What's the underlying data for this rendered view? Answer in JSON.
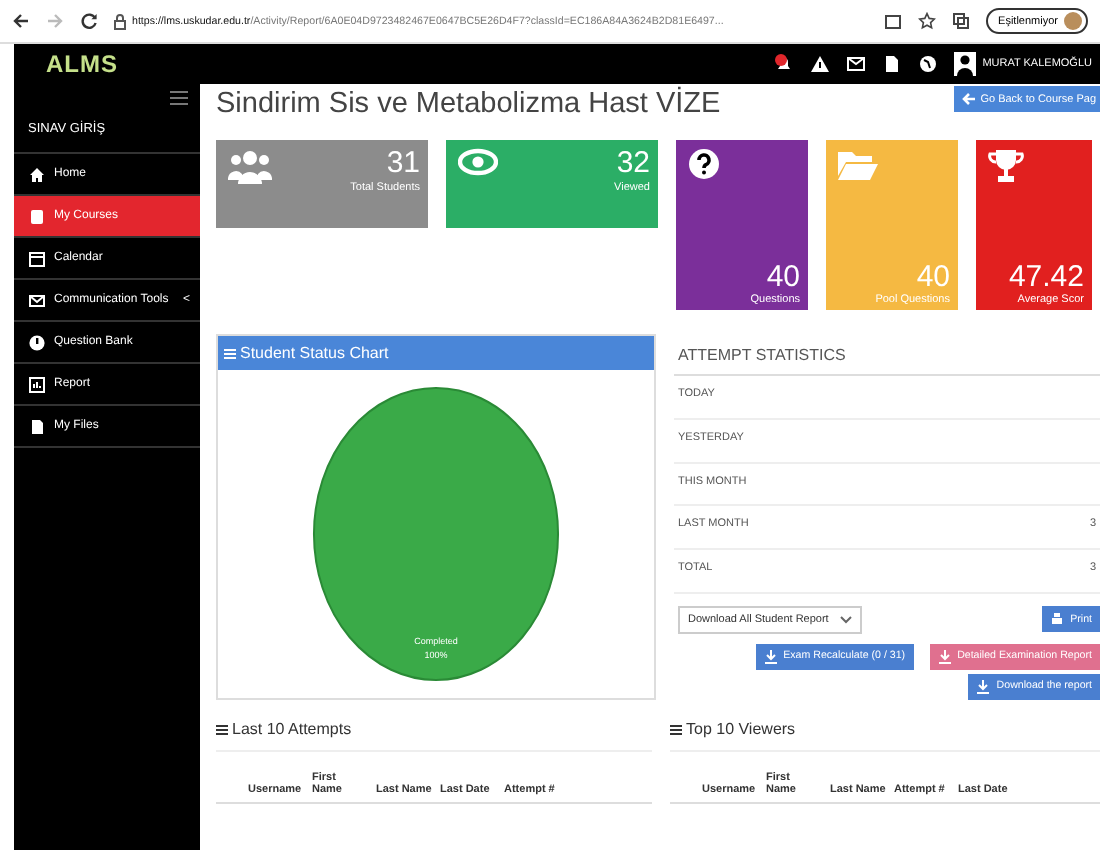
{
  "browser": {
    "url_host": "https://lms.uskudar.edu.tr",
    "url_path": "/Activity/Report/6A0E04D9723482467E0647BC5E26D4F7?classId=EC186A84A3624B2D81E6497...",
    "profile": "Eşitlenmiyor"
  },
  "topbar": {
    "logo": "ALMS",
    "notification": true,
    "user": "MURAT KALEMOĞLU"
  },
  "sidebar": {
    "heading": "SINAV GİRİŞ",
    "items": [
      {
        "label": "Home",
        "selected": false
      },
      {
        "label": "My Courses",
        "selected": true
      },
      {
        "label": "Calendar",
        "selected": false
      },
      {
        "label": "Communication Tools",
        "selected": false,
        "caret": "<"
      },
      {
        "label": "Question Bank",
        "selected": false
      },
      {
        "label": "Report",
        "selected": false
      },
      {
        "label": "My Files",
        "selected": false
      }
    ]
  },
  "page": {
    "title": "Sindirim Sis ve Metabolizma Hast VİZE",
    "back_button": "Go Back to Course Pag"
  },
  "stats": [
    {
      "kind": "short",
      "value": "31",
      "label": "Total Students",
      "color": "#8c8c8c"
    },
    {
      "kind": "short",
      "value": "32",
      "label": "Viewed",
      "color": "#2bae66"
    },
    {
      "kind": "tall",
      "value": "40",
      "label": "Questions",
      "color": "#7b2f9a"
    },
    {
      "kind": "tall",
      "value": "40",
      "label": "Pool Questions",
      "color": "#f5b942"
    },
    {
      "kind": "tall",
      "value": "47.42",
      "label": "Average Scor",
      "color": "#e1201f"
    }
  ],
  "status_chart": {
    "title": "Student Status Chart",
    "chart_data": {
      "type": "pie",
      "categories": [
        "Completed"
      ],
      "values": [
        100
      ],
      "value_labels": [
        "100%"
      ]
    }
  },
  "attempt_statistics": {
    "title": "ATTEMPT STATISTICS",
    "rows": [
      {
        "label": "TODAY"
      },
      {
        "label": "YESTERDAY"
      },
      {
        "label": "THIS MONTH"
      },
      {
        "label": "LAST MONTH",
        "value": "3"
      },
      {
        "label": "TOTAL",
        "value": "3"
      }
    ],
    "report_select": "Download All Student Report",
    "print_button": "Print",
    "recalc_button": "Exam Recalculate (0 / 31)",
    "detailed_button": "Detailed Examination Report",
    "download_button": "Download the report"
  },
  "last_attempts": {
    "title": "Last 10 Attempts",
    "columns": [
      "Username",
      "First Name",
      "Last Name",
      "Last Date",
      "Attempt #"
    ]
  },
  "top_viewers": {
    "title": "Top 10 Viewers",
    "columns": [
      "Username",
      "First Name",
      "Last Name",
      "Attempt #",
      "Last Date"
    ]
  }
}
